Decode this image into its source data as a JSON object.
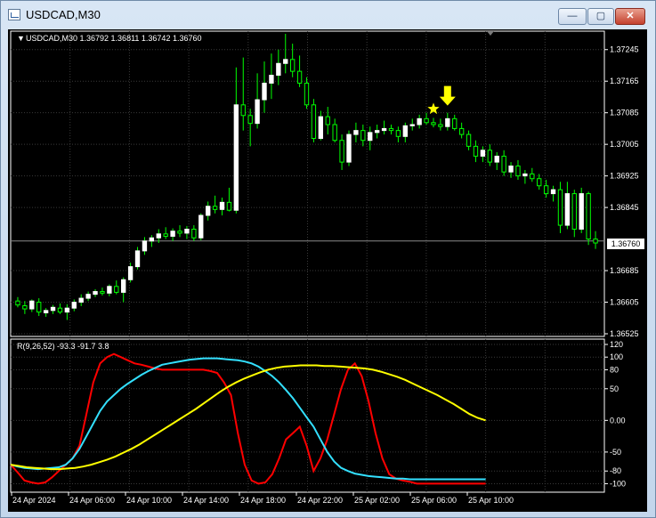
{
  "window": {
    "title": "USDCAD,M30",
    "buttons": {
      "minimize": "—",
      "maximize": "▢",
      "close": "✕"
    }
  },
  "main_chart": {
    "header": "USDCAD,M30  1.36792 1.36811 1.36742 1.36760",
    "current_price_label": "1.36760"
  },
  "indicator": {
    "header": "R(9,26,52) -93.3 -91.7 3.8"
  },
  "colors": {
    "background": "#000000",
    "grid": "#3a3a3a",
    "bull_candle": "#ffffff",
    "wick": "#00ff00",
    "line_fast": "#ff0000",
    "line_mid": "#33e0ff",
    "line_slow": "#ffff00",
    "arrow": "#ffff00"
  },
  "chart_data": [
    {
      "type": "candlestick",
      "title": "USDCAD,M30",
      "ylim": [
        1.36525,
        1.37285
      ],
      "y_ticks": [
        "1.37245",
        "1.37165",
        "1.37085",
        "1.37005",
        "1.36925",
        "1.36845",
        "1.36685",
        "1.36605",
        "1.36525"
      ],
      "current_price": 1.3676,
      "markers": [
        {
          "kind": "star",
          "index": 59
        },
        {
          "kind": "down-arrow",
          "index": 61
        }
      ],
      "ohlc": [
        [
          1.36608,
          1.36618,
          1.36592,
          1.36598
        ],
        [
          1.36596,
          1.36608,
          1.36575,
          1.36588
        ],
        [
          1.36588,
          1.36612,
          1.3658,
          1.36608
        ],
        [
          1.36605,
          1.36615,
          1.3657,
          1.3658
        ],
        [
          1.36578,
          1.3659,
          1.36568,
          1.36584
        ],
        [
          1.36584,
          1.36598,
          1.36575,
          1.36592
        ],
        [
          1.3659,
          1.36602,
          1.36575,
          1.3658
        ],
        [
          1.3658,
          1.366,
          1.3656,
          1.3659
        ],
        [
          1.3659,
          1.36612,
          1.36582,
          1.36605
        ],
        [
          1.36605,
          1.36625,
          1.36595,
          1.36615
        ],
        [
          1.36615,
          1.36632,
          1.36608,
          1.36625
        ],
        [
          1.36625,
          1.36638,
          1.36618,
          1.36632
        ],
        [
          1.36632,
          1.36642,
          1.36622,
          1.36628
        ],
        [
          1.36628,
          1.3665,
          1.3662,
          1.36645
        ],
        [
          1.36645,
          1.3666,
          1.36625,
          1.3663
        ],
        [
          1.3663,
          1.36668,
          1.36605,
          1.36662
        ],
        [
          1.36662,
          1.36705,
          1.36655,
          1.36695
        ],
        [
          1.36695,
          1.36745,
          1.36688,
          1.36735
        ],
        [
          1.36735,
          1.3677,
          1.36725,
          1.3676
        ],
        [
          1.3676,
          1.36775,
          1.36745,
          1.36768
        ],
        [
          1.36768,
          1.3679,
          1.36755,
          1.36778
        ],
        [
          1.36778,
          1.36795,
          1.36765,
          1.36772
        ],
        [
          1.36772,
          1.36792,
          1.3676,
          1.36785
        ],
        [
          1.36785,
          1.368,
          1.3677,
          1.3678
        ],
        [
          1.3678,
          1.36798,
          1.36765,
          1.3679
        ],
        [
          1.3679,
          1.368,
          1.3676,
          1.36768
        ],
        [
          1.36768,
          1.3683,
          1.36762,
          1.36825
        ],
        [
          1.36825,
          1.3686,
          1.36812,
          1.36848
        ],
        [
          1.36848,
          1.36875,
          1.3683,
          1.3684
        ],
        [
          1.3684,
          1.3687,
          1.36825,
          1.36858
        ],
        [
          1.36858,
          1.36895,
          1.36835,
          1.36838
        ],
        [
          1.36838,
          1.372,
          1.3683,
          1.37105
        ],
        [
          1.37105,
          1.37225,
          1.3704,
          1.37078
        ],
        [
          1.37078,
          1.37095,
          1.37,
          1.37058
        ],
        [
          1.37058,
          1.37185,
          1.37045,
          1.37118
        ],
        [
          1.37118,
          1.37215,
          1.37085,
          1.3716
        ],
        [
          1.3716,
          1.37235,
          1.3712,
          1.3718
        ],
        [
          1.3718,
          1.37245,
          1.37155,
          1.3721
        ],
        [
          1.3721,
          1.37285,
          1.37185,
          1.3722
        ],
        [
          1.3722,
          1.3726,
          1.37175,
          1.3719
        ],
        [
          1.3719,
          1.3723,
          1.3715,
          1.3716
        ],
        [
          1.3716,
          1.37175,
          1.37095,
          1.37105
        ],
        [
          1.37105,
          1.3712,
          1.3701,
          1.3702
        ],
        [
          1.3702,
          1.3709,
          1.37015,
          1.37075
        ],
        [
          1.37075,
          1.371,
          1.3703,
          1.37055
        ],
        [
          1.37055,
          1.3707,
          1.3701,
          1.37015
        ],
        [
          1.37015,
          1.3703,
          1.3694,
          1.3696
        ],
        [
          1.3696,
          1.3704,
          1.3695,
          1.3703
        ],
        [
          1.3703,
          1.3706,
          1.3701,
          1.3704
        ],
        [
          1.3704,
          1.37055,
          1.37,
          1.37015
        ],
        [
          1.37015,
          1.3705,
          1.3699,
          1.37035
        ],
        [
          1.37035,
          1.37055,
          1.3702,
          1.3704
        ],
        [
          1.3704,
          1.37065,
          1.3703,
          1.37045
        ],
        [
          1.37045,
          1.37055,
          1.3703,
          1.3704
        ],
        [
          1.3704,
          1.3705,
          1.3701,
          1.37025
        ],
        [
          1.37025,
          1.3706,
          1.3701,
          1.37052
        ],
        [
          1.37052,
          1.3707,
          1.3704,
          1.37055
        ],
        [
          1.37055,
          1.3708,
          1.37045,
          1.3707
        ],
        [
          1.3707,
          1.37085,
          1.37055,
          1.3706
        ],
        [
          1.3706,
          1.37072,
          1.37048,
          1.37055
        ],
        [
          1.37055,
          1.3707,
          1.3704,
          1.3705
        ],
        [
          1.3705,
          1.37085,
          1.3704,
          1.3707
        ],
        [
          1.3707,
          1.3708,
          1.3704,
          1.37045
        ],
        [
          1.37045,
          1.3706,
          1.3702,
          1.3703
        ],
        [
          1.3703,
          1.3704,
          1.3699,
          1.37
        ],
        [
          1.37,
          1.37015,
          1.3696,
          1.36975
        ],
        [
          1.36975,
          1.37,
          1.3696,
          1.3699
        ],
        [
          1.3699,
          1.37005,
          1.3695,
          1.3696
        ],
        [
          1.3696,
          1.36985,
          1.3694,
          1.36975
        ],
        [
          1.36975,
          1.3699,
          1.36925,
          1.36935
        ],
        [
          1.36935,
          1.3696,
          1.3692,
          1.3695
        ],
        [
          1.3695,
          1.36965,
          1.36915,
          1.36925
        ],
        [
          1.36925,
          1.3694,
          1.36905,
          1.3693
        ],
        [
          1.3693,
          1.36945,
          1.3691,
          1.36918
        ],
        [
          1.36918,
          1.3693,
          1.3689,
          1.369
        ],
        [
          1.369,
          1.36915,
          1.3687,
          1.3688
        ],
        [
          1.3688,
          1.369,
          1.3686,
          1.3689
        ],
        [
          1.3689,
          1.3691,
          1.3678,
          1.368
        ],
        [
          1.368,
          1.3691,
          1.3679,
          1.3688
        ],
        [
          1.3688,
          1.3689,
          1.3677,
          1.3679
        ],
        [
          1.3679,
          1.36895,
          1.3678,
          1.3688
        ],
        [
          1.3688,
          1.36885,
          1.3675,
          1.36765
        ],
        [
          1.36765,
          1.36785,
          1.3674,
          1.36755
        ]
      ],
      "time_labels": [
        "24 Apr 2024",
        "24 Apr 06:00",
        "24 Apr 10:00",
        "24 Apr 14:00",
        "24 Apr 18:00",
        "24 Apr 22:00",
        "25 Apr 02:00",
        "25 Apr 06:00",
        "25 Apr 10:00"
      ]
    },
    {
      "type": "line",
      "title": "R(9,26,52)",
      "ylim": [
        -105,
        120
      ],
      "y_ticks": [
        "120",
        "100",
        "80",
        "50",
        "0.00",
        "-50",
        "-80",
        "-100"
      ],
      "series": [
        {
          "values": [
            -70,
            -82,
            -95,
            -98,
            -100,
            -98,
            -90,
            -80,
            -70,
            -60,
            -40,
            10,
            60,
            90,
            100,
            105,
            100,
            95,
            90,
            88,
            85,
            82,
            80,
            80,
            80,
            80,
            80,
            80,
            80,
            78,
            75,
            60,
            40,
            -20,
            -70,
            -95,
            -100,
            -98,
            -85,
            -60,
            -30,
            -20,
            -10,
            -40,
            -80,
            -60,
            -30,
            10,
            50,
            80,
            90,
            70,
            30,
            -20,
            -60,
            -85,
            -92,
            -95,
            -97,
            -100,
            -100,
            -100,
            -100,
            -100,
            -100,
            -100,
            -100,
            -100,
            -100,
            -100
          ]
        },
        {
          "values": [
            -70,
            -73,
            -75,
            -76,
            -77,
            -76,
            -75,
            -74,
            -70,
            -60,
            -45,
            -25,
            -5,
            15,
            30,
            40,
            50,
            58,
            65,
            72,
            78,
            83,
            88,
            90,
            92,
            94,
            96,
            97,
            98,
            98,
            98,
            97,
            96,
            95,
            93,
            90,
            85,
            78,
            70,
            60,
            48,
            35,
            20,
            5,
            -10,
            -30,
            -50,
            -65,
            -75,
            -80,
            -84,
            -86,
            -88,
            -89,
            -90,
            -91,
            -92,
            -92,
            -93,
            -93,
            -93,
            -93,
            -93,
            -93,
            -93,
            -93,
            -93,
            -93,
            -93,
            -93
          ]
        },
        {
          "values": [
            -70,
            -72,
            -74,
            -75,
            -76,
            -77,
            -77,
            -76,
            -75,
            -73,
            -70,
            -66,
            -62,
            -57,
            -51,
            -45,
            -38,
            -30,
            -22,
            -14,
            -6,
            2,
            10,
            18,
            27,
            36,
            45,
            53,
            60,
            66,
            71,
            76,
            80,
            83,
            85,
            86,
            87,
            87,
            87,
            86,
            86,
            85,
            84,
            83,
            82,
            80,
            77,
            73,
            69,
            64,
            58,
            52,
            46,
            40,
            33,
            26,
            18,
            10,
            4,
            0
          ]
        }
      ],
      "time_labels": [
        "24 Apr 2024",
        "24 Apr 06:00",
        "24 Apr 10:00",
        "24 Apr 14:00",
        "24 Apr 18:00",
        "24 Apr 22:00",
        "25 Apr 02:00",
        "25 Apr 06:00",
        "25 Apr 10:00"
      ]
    }
  ]
}
